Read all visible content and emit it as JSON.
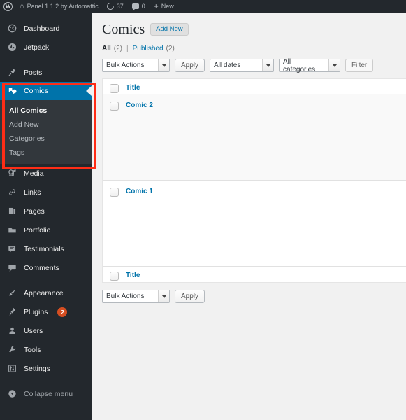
{
  "adminbar": {
    "logo_icon": "wordpress-logo-icon",
    "site_home_icon": "home-icon",
    "site_name": "Panel 1.1.2 by Automattic",
    "updates_icon": "updates-icon",
    "updates_count": "37",
    "comments_icon": "comments-icon",
    "comments_count": "0",
    "new_icon": "plus-icon",
    "new_label": "New"
  },
  "sidebar": {
    "items": [
      {
        "label": "Dashboard",
        "icon": "dashboard-gauge-icon",
        "name": "dashboard"
      },
      {
        "label": "Jetpack",
        "icon": "jetpack-icon",
        "name": "jetpack"
      },
      {
        "label": "Posts",
        "icon": "pin-icon",
        "name": "posts"
      },
      {
        "label": "Comics",
        "icon": "comics-icon",
        "name": "comics"
      },
      {
        "label": "Media",
        "icon": "media-icon",
        "name": "media"
      },
      {
        "label": "Links",
        "icon": "link-chain-icon",
        "name": "links"
      },
      {
        "label": "Pages",
        "icon": "pages-icon",
        "name": "pages"
      },
      {
        "label": "Portfolio",
        "icon": "portfolio-icon",
        "name": "portfolio"
      },
      {
        "label": "Testimonials",
        "icon": "testimonials-icon",
        "name": "testimonials"
      },
      {
        "label": "Comments",
        "icon": "comment-bubble-icon",
        "name": "comments"
      },
      {
        "label": "Appearance",
        "icon": "paintbrush-icon",
        "name": "appearance"
      },
      {
        "label": "Plugins",
        "icon": "plug-icon",
        "name": "plugins",
        "badge": "2"
      },
      {
        "label": "Users",
        "icon": "user-icon",
        "name": "users"
      },
      {
        "label": "Tools",
        "icon": "wrench-icon",
        "name": "tools"
      },
      {
        "label": "Settings",
        "icon": "settings-sliders-icon",
        "name": "settings"
      },
      {
        "label": "Collapse menu",
        "icon": "collapse-arrow-icon",
        "name": "collapse-menu"
      }
    ],
    "comics_submenu": [
      {
        "label": "All Comics",
        "current": true
      },
      {
        "label": "Add New",
        "current": false
      },
      {
        "label": "Categories",
        "current": false
      },
      {
        "label": "Tags",
        "current": false
      }
    ],
    "current_item": "Comics",
    "accent_color": "#0073aa",
    "badge_color": "#d54e21",
    "background_color": "#23282d",
    "submenu_background": "#32373c"
  },
  "annotation": {
    "color": "#ff2d16",
    "target": "Comics menu and submenu"
  },
  "main": {
    "page_title": "Comics",
    "add_new_label": "Add New",
    "views": {
      "all_label": "All",
      "all_count": "(2)",
      "separator": "|",
      "published_label": "Published",
      "published_count": "(2)"
    },
    "toolbar_top": {
      "bulk_actions": "Bulk Actions",
      "apply_label": "Apply",
      "dates_filter": "All dates",
      "categories_filter": "All categories",
      "filter_label": "Filter"
    },
    "toolbar_bottom": {
      "bulk_actions": "Bulk Actions",
      "apply_label": "Apply"
    },
    "table": {
      "header_title": "Title",
      "footer_title": "Title",
      "rows": [
        {
          "title": "Comic 2"
        },
        {
          "title": "Comic 1"
        }
      ]
    }
  }
}
